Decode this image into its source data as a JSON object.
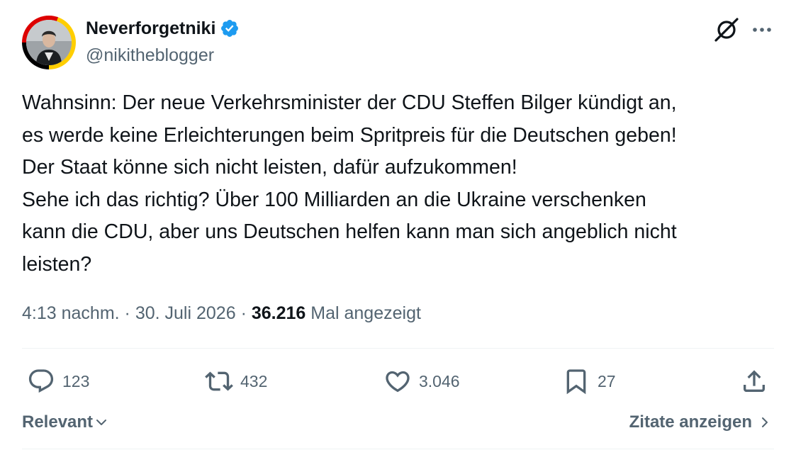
{
  "author": {
    "display_name": "Neverforgetniki",
    "handle": "@nikitheblogger",
    "verified": true,
    "verified_color": "#1d9bf0",
    "avatar_icon": "profile-photo"
  },
  "header_actions": {
    "grok_icon": "grok-icon",
    "more_icon": "more-dots-icon"
  },
  "tweet": {
    "lines": [
      "Wahnsinn: Der neue Verkehrsminister der CDU Steffen Bilger kündigt an,",
      "es werde keine Erleichterungen beim Spritpreis für die Deutschen geben!",
      "Der Staat könne sich nicht leisten, dafür aufzukommen!",
      "Sehe ich das richtig? Über 100 Milliarden an die Ukraine verschenken",
      "kann die CDU, aber uns Deutschen helfen kann man sich angeblich nicht",
      "leisten?"
    ]
  },
  "meta": {
    "time": "4:13 nachm.",
    "separator": "·",
    "date": "30. Juli 2026",
    "views_count": "36.216",
    "views_label": "Mal angezeigt"
  },
  "actions": {
    "replies": "123",
    "reposts": "432",
    "likes": "3.046",
    "bookmarks": "27"
  },
  "sort": {
    "label": "Relevant"
  },
  "quotes": {
    "label": "Zitate anzeigen"
  },
  "colors": {
    "text_primary": "#0f1419",
    "text_secondary": "#536471",
    "divider": "#eff3f4",
    "verified": "#1d9bf0"
  }
}
